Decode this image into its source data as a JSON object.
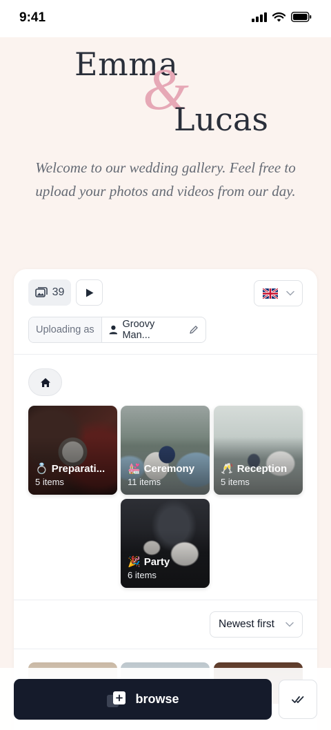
{
  "status_bar": {
    "time": "9:41"
  },
  "hero": {
    "name_first": "Emma",
    "ampersand": "&",
    "name_second": "Lucas",
    "welcome": "Welcome to our wedding gallery. Feel free to upload your photos and videos from our day."
  },
  "toolbar": {
    "media_count": "39",
    "language_flag": "uk-flag-icon",
    "uploading_label": "Uploading as",
    "uploader_name": "Groovy Man..."
  },
  "albums": [
    {
      "title": "Preparati...",
      "emoji": "💍",
      "count": "5 items"
    },
    {
      "title": "Ceremony",
      "emoji": "💒",
      "count": "11 items"
    },
    {
      "title": "Reception",
      "emoji": "🥂",
      "count": "5 items"
    },
    {
      "title": "Party",
      "emoji": "🎉",
      "count": "6 items"
    }
  ],
  "sort": {
    "selected": "Newest first"
  },
  "bottom": {
    "browse_label": "browse"
  },
  "colors": {
    "background": "#fbf3ef",
    "accent_pink": "#e6a8b6",
    "primary_dark": "#151b2b"
  }
}
